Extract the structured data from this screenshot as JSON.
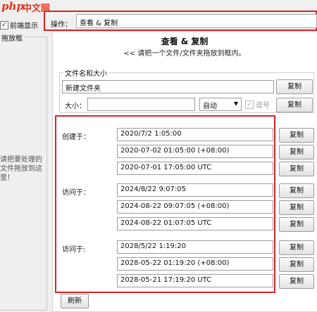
{
  "logo": {
    "php": "php",
    "cn": "中文网"
  },
  "left": {
    "checkbox_label": "前端显示",
    "checkbox_mark": "✓",
    "frame_title": "拖放框",
    "drop_hint": "请把要处理的文件拖放到这里！"
  },
  "ops": {
    "label": "操作：",
    "value": "查看 & 复制"
  },
  "panel": {
    "title": "查看 & 复制",
    "subtitle": "<< 请把一个文件/文件夹拖放到框内。"
  },
  "name_size": {
    "group_title": "文件名和大小",
    "filename": "新建文件夹",
    "copy": "复制",
    "size_label": "大小：",
    "size_value": "",
    "unit_select": "自动",
    "comma_label": "逗号",
    "comma_mark": "✓"
  },
  "times": [
    {
      "label": "创建于：",
      "values": [
        "2020/7/2 1:05:00",
        "2020-07-02 01:05:00 (+08:00)",
        "2020-07-01 17:05:00 UTC"
      ]
    },
    {
      "label": "访问于：",
      "values": [
        "2024/8/22 9:07:05",
        "2024-08-22 09:07:05 (+08:00)",
        "2024-08-22 01:07:05 UTC"
      ]
    },
    {
      "label": "访问于:",
      "values": [
        "2028/5/22 1:19:20",
        "2028-05-22 01:19:20 (+08:00)",
        "2028-05-21 17:19:20 UTC"
      ]
    }
  ],
  "copy_label": "复制",
  "refresh": "刷新",
  "icons": {
    "dropdown": "chevron-down-icon",
    "check": "check-icon"
  },
  "colors": {
    "highlight": "#d2252a",
    "logo": "#e8331b"
  }
}
